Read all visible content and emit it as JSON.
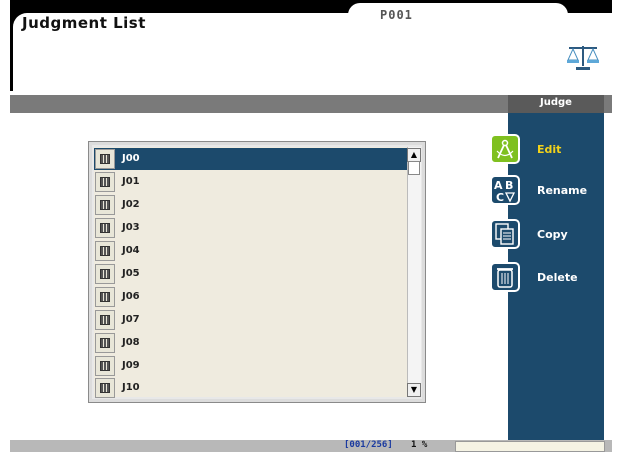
{
  "header": {
    "title": "Judgment List",
    "tab": "P001",
    "icon": "balance-scale-icon"
  },
  "section": {
    "label": "Judge"
  },
  "actions": [
    {
      "label": "Edit",
      "icon": "edit-compass-icon"
    },
    {
      "label": "Rename",
      "icon": "rename-abc-icon"
    },
    {
      "label": "Copy",
      "icon": "copy-pages-icon"
    },
    {
      "label": "Delete",
      "icon": "trash-icon"
    }
  ],
  "list": {
    "selected_index": 0,
    "items": [
      "J00",
      "J01",
      "J02",
      "J03",
      "J04",
      "J05",
      "J06",
      "J07",
      "J08",
      "J09",
      "J10"
    ]
  },
  "status": {
    "count": "[001/256]",
    "percent": "1 %"
  },
  "colors": {
    "panel": "#1c4a6c",
    "edit_accent": "#f2d21a",
    "edit_icon": "#7fc020",
    "count_text": "#1a3aa0"
  }
}
